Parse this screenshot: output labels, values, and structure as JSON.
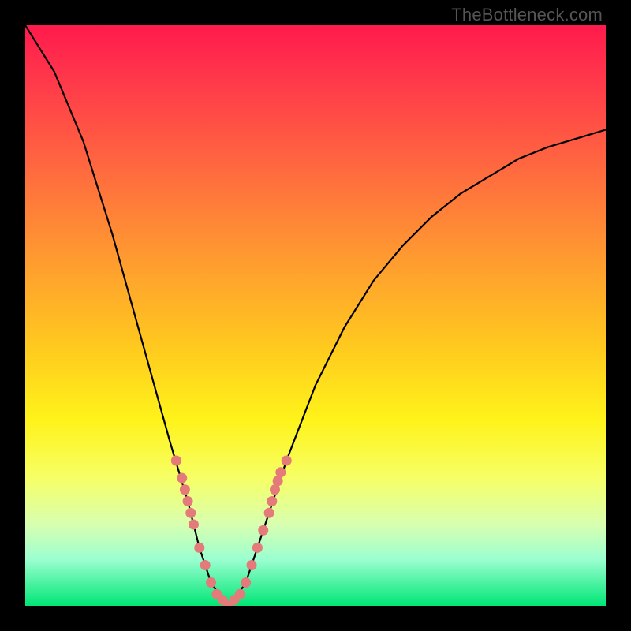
{
  "watermark": {
    "text": "TheBottleneck.com"
  },
  "colors": {
    "background": "#000000",
    "gradient_top": "#ff1a4d",
    "gradient_bottom": "#00e676",
    "curve": "#000000",
    "marker": "#e47a7a"
  },
  "chart_data": {
    "type": "line",
    "title": "",
    "xlabel": "",
    "ylabel": "",
    "xlim": [
      0,
      100
    ],
    "ylim": [
      0,
      100
    ],
    "grid": false,
    "legend": false,
    "background": "rainbow-gradient-red-to-green",
    "series": [
      {
        "name": "bottleneck-curve",
        "x": [
          0,
          5,
          10,
          15,
          20,
          25,
          28,
          30,
          32,
          34,
          35,
          36,
          38,
          40,
          45,
          50,
          55,
          60,
          65,
          70,
          75,
          80,
          85,
          90,
          95,
          100
        ],
        "y": [
          100,
          92,
          80,
          64,
          46,
          28,
          18,
          10,
          4,
          1,
          0,
          1,
          4,
          10,
          25,
          38,
          48,
          56,
          62,
          67,
          71,
          74,
          77,
          79,
          80.5,
          82
        ],
        "color": "#000000",
        "stroke_width": 2
      }
    ],
    "markers": [
      {
        "name": "highlight-points-left",
        "shape": "circle",
        "color": "#e47a7a",
        "points": [
          {
            "x": 26,
            "y": 25
          },
          {
            "x": 27,
            "y": 22
          },
          {
            "x": 27.5,
            "y": 20
          },
          {
            "x": 28,
            "y": 18
          },
          {
            "x": 28.5,
            "y": 16
          },
          {
            "x": 29,
            "y": 14
          },
          {
            "x": 30,
            "y": 10
          },
          {
            "x": 31,
            "y": 7
          },
          {
            "x": 32,
            "y": 4
          },
          {
            "x": 33,
            "y": 2
          },
          {
            "x": 34,
            "y": 1
          }
        ]
      },
      {
        "name": "highlight-points-bottom",
        "shape": "circle",
        "color": "#e47a7a",
        "points": [
          {
            "x": 35,
            "y": 0
          },
          {
            "x": 36,
            "y": 1
          },
          {
            "x": 37,
            "y": 2
          }
        ]
      },
      {
        "name": "highlight-points-right",
        "shape": "circle",
        "color": "#e47a7a",
        "points": [
          {
            "x": 38,
            "y": 4
          },
          {
            "x": 39,
            "y": 7
          },
          {
            "x": 40,
            "y": 10
          },
          {
            "x": 41,
            "y": 13
          },
          {
            "x": 42,
            "y": 16
          },
          {
            "x": 42.5,
            "y": 18
          },
          {
            "x": 43,
            "y": 20
          },
          {
            "x": 43.5,
            "y": 21.5
          },
          {
            "x": 44,
            "y": 23
          },
          {
            "x": 45,
            "y": 25
          }
        ]
      }
    ]
  }
}
